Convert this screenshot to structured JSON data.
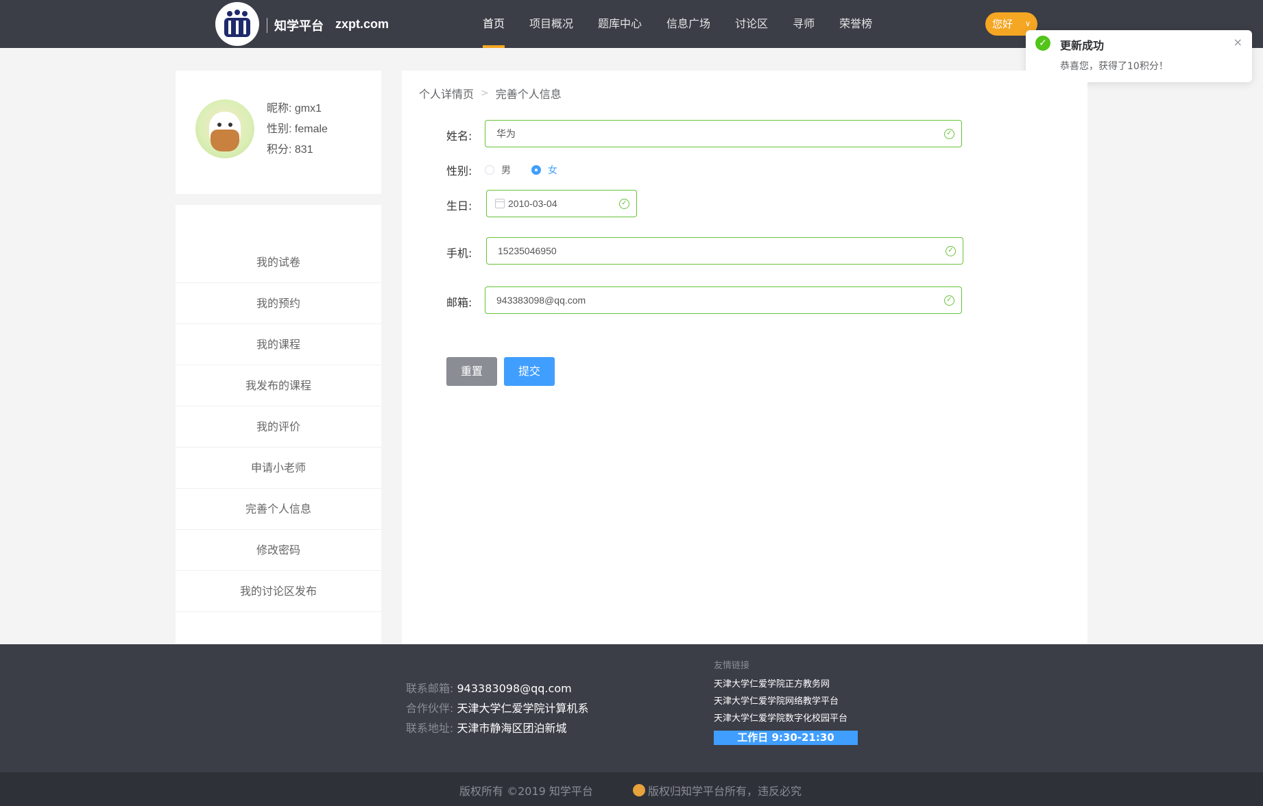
{
  "header": {
    "brand_name": "知学平台",
    "brand_domain": "zxpt.com",
    "nav": [
      "首页",
      "项目概况",
      "题库中心",
      "信息广场",
      "讨论区",
      "寻师",
      "荣誉榜"
    ],
    "user_button": "您好"
  },
  "toast": {
    "title": "更新成功",
    "message": "恭喜您，获得了10积分！",
    "close": "×"
  },
  "profile": {
    "nickname": "昵称: gmx1",
    "gender": "性别: female",
    "points": "积分: 831"
  },
  "sidebar": {
    "items": [
      "我的试卷",
      "我的预约",
      "我的课程",
      "我发布的课程",
      "我的评价",
      "申请小老师",
      "完善个人信息",
      "修改密码",
      "我的讨论区发布"
    ]
  },
  "breadcrumb": {
    "parent": "个人详情页",
    "current": "完善个人信息"
  },
  "form": {
    "name_label": "姓名:",
    "name_value": "华为",
    "gender_label": "性别:",
    "gender_options": [
      "男",
      "女"
    ],
    "gender_selected": "女",
    "birthday_label": "生日:",
    "birthday_value": "2010-03-04",
    "phone_label": "手机:",
    "phone_value": "15235046950",
    "email_label": "邮箱:",
    "email_value": "943383098@qq.com",
    "reset_label": "重置",
    "submit_label": "提交"
  },
  "footer": {
    "contact_email_key": "联系邮箱:",
    "contact_email_value": "943383098@qq.com",
    "partner_key": "合作伙伴:",
    "partner_value": "天津大学仁爱学院计算机系",
    "address_key": "联系地址:",
    "address_value": "天津市静海区团泊新城",
    "links_title": "友情链接",
    "links": [
      "天津大学仁爱学院正方教务网",
      "天津大学仁爱学院网络教学平台",
      "天津大学仁爱学院数字化校园平台"
    ],
    "hours": "工作日 9:30-21:30",
    "copyright_left": "版权所有 ©2019 知学平台",
    "copyright_right": "版权归知学平台所有，违反必究"
  },
  "colors": {
    "header_bg": "#3b3d47",
    "accent_orange": "#f5a623",
    "primary_blue": "#409eff",
    "success_green": "#67c23a"
  }
}
